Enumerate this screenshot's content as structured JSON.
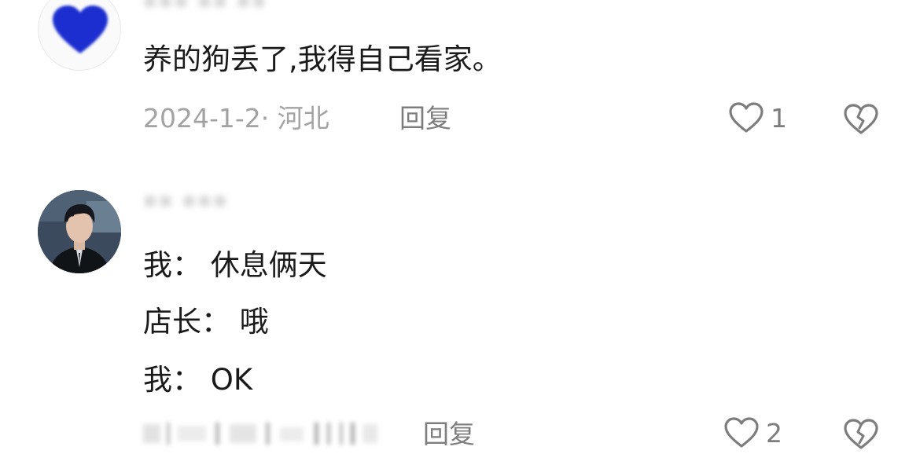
{
  "comments": [
    {
      "avatar": "blue-heart-avatar",
      "lines": [
        "养的狗丢了,我得自己看家。"
      ],
      "meta": "2024-1-2· 河北",
      "reply_label": "回复",
      "like_count": "1"
    },
    {
      "avatar": "man-portrait-avatar",
      "lines": [
        "我： 休息俩天",
        "店长： 哦",
        "我： OK"
      ],
      "reply_label": "回复",
      "like_count": "2"
    }
  ],
  "colors": {
    "text": "#1a1a1a",
    "meta": "#a3a3a3",
    "action": "#7d7d7d",
    "heart_avatar": "#1a2fd0"
  },
  "icons": [
    "heart-outline-icon",
    "broken-heart-icon"
  ]
}
